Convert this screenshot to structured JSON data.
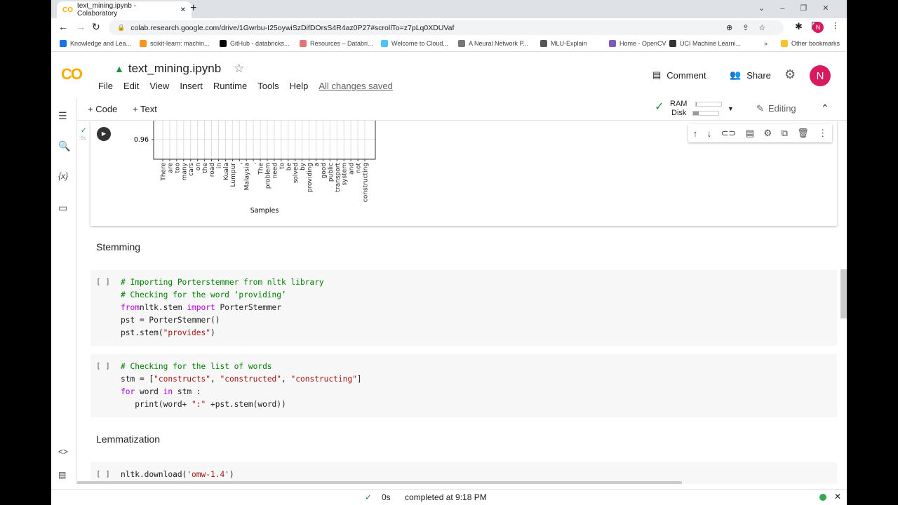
{
  "browser": {
    "tab_title": "text_mining.ipynb - Colaboratory",
    "url": "colab.research.google.com/drive/1Gwrbu-I25oywiSzDifDOrsS4R4az0P27#scrollTo=z7pLq0XDUVaf",
    "profile": "N",
    "bookmarks": [
      "Knowledge and Lea...",
      "scikit-learn: machin...",
      "GitHub - databricks...",
      "Resources – Databri...",
      "Welcome to Cloud...",
      "A Neural Network P...",
      "MLU-Explain",
      "Home - OpenCV",
      "UCI Machine Learni..."
    ],
    "more": "»",
    "other_bookmarks": "Other bookmarks"
  },
  "colab": {
    "logo": "CO",
    "notebook_title": "text_mining.ipynb",
    "menu": [
      "File",
      "Edit",
      "View",
      "Insert",
      "Runtime",
      "Tools",
      "Help"
    ],
    "saved": "All changes saved",
    "comment": "Comment",
    "share": "Share",
    "avatar": "N",
    "toolbar": {
      "code": "+ Code",
      "text": "+ Text",
      "ram": "RAM",
      "disk": "Disk",
      "ram_usage": 0.05,
      "disk_usage": 0.2,
      "editing": "Editing"
    }
  },
  "output_cell": {
    "exec_time": "0s"
  },
  "chart_data": {
    "type": "line",
    "ylabel": "",
    "xlabel": "Samples",
    "y_ticks": [
      "0.96"
    ],
    "grid": true,
    "categories": [
      "There",
      "are",
      "too",
      "many",
      "cars",
      "on",
      "the",
      "road",
      "in",
      "Kuala",
      "Lumpur",
      ",",
      "Malaysia",
      ".",
      "The",
      "problem",
      "need",
      "to",
      "be",
      "solved",
      "by",
      "providing",
      "a",
      "good",
      "public",
      "transport",
      "system",
      "and",
      "not",
      "constructing"
    ]
  },
  "sections": {
    "stemming": "Stemming",
    "lemmatization": "Lemmatization"
  },
  "cells": [
    {
      "bracket": "[ ]",
      "lines": [
        [
          [
            "cm",
            "# Importing Porterstemmer from nltk library"
          ]
        ],
        [
          [
            "cm",
            "# Checking for the word ‘providing’"
          ]
        ],
        [
          [
            "kw",
            "from"
          ],
          [
            "",
            "nltk.stem "
          ],
          [
            "kw",
            "import"
          ],
          [
            "",
            " PorterStemmer"
          ]
        ],
        [
          [
            "",
            "pst = PorterStemmer()"
          ]
        ],
        [
          [
            "",
            "pst.stem("
          ],
          [
            "st",
            "\"provides\""
          ],
          [
            "",
            ")"
          ]
        ]
      ]
    },
    {
      "bracket": "[ ]",
      "lines": [
        [
          [
            "cm",
            "# Checking for the list of words"
          ]
        ],
        [
          [
            "",
            "stm = ["
          ],
          [
            "st",
            "\"constructs\""
          ],
          [
            "",
            ", "
          ],
          [
            "st",
            "\"constructed\""
          ],
          [
            "",
            ", "
          ],
          [
            "st",
            "\"constructing\""
          ],
          [
            "",
            "]"
          ]
        ],
        [
          [
            "kw",
            "for"
          ],
          [
            "",
            " word "
          ],
          [
            "kw",
            "in"
          ],
          [
            "",
            " stm :"
          ]
        ],
        [
          [
            "",
            "   print(word+ "
          ],
          [
            "st",
            "\":\""
          ],
          [
            "",
            " +pst.stem(word))"
          ]
        ]
      ]
    },
    {
      "bracket": "[ ]",
      "lines": [
        [
          [
            "",
            "nltk.download("
          ],
          [
            "st",
            "'omw-1.4'"
          ],
          [
            "",
            ")"
          ]
        ]
      ]
    }
  ],
  "status": {
    "time": "0s",
    "message": "completed at 9:18 PM"
  }
}
